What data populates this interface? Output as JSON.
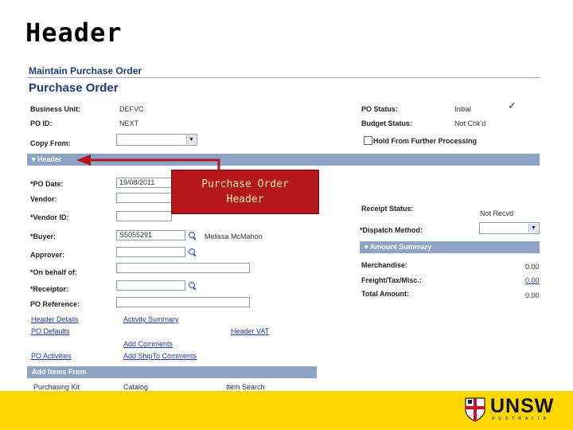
{
  "slide": {
    "title": "Header"
  },
  "app": {
    "breadcrumb": "Maintain Purchase Order",
    "page_title": "Purchase Order"
  },
  "top_fields": {
    "business_unit_label": "Business Unit:",
    "business_unit_value": "DEFVC",
    "po_id_label": "PO ID:",
    "po_id_value": "NEXT",
    "copy_from_label": "Copy From:",
    "po_status_label": "PO Status:",
    "po_status_value": "Initial",
    "budget_status_label": "Budget Status:",
    "budget_status_value": "Not Chk'd",
    "hold_label": "Hold From Further Processing"
  },
  "header_section": {
    "label": "Header"
  },
  "header_fields": {
    "po_date_label": "*PO Date:",
    "po_date_value": "19/08/2011",
    "vendor_label": "Vendor:",
    "vendor_id_label": "*Vendor ID:",
    "buyer_label": "*Buyer:",
    "buyer_value": "S5055291",
    "buyer_name": "Melissa McMahon",
    "approver_label": "Approver:",
    "on_behalf_label": "*On behalf of:",
    "receiptor_label": "*Receiptor:",
    "po_reference_label": "PO Reference:",
    "receipt_status_label": "Receipt Status:",
    "receipt_status_value": "Not Recvd",
    "dispatch_method_label": "*Dispatch Method:"
  },
  "amount_summary": {
    "title": "Amount Summary",
    "merchandise_label": "Merchandise:",
    "merchandise_value": "0.00",
    "freight_label": "Freight/Tax/Misc.:",
    "freight_value": "0.00",
    "total_label": "Total Amount:",
    "total_value": "0.00"
  },
  "links": {
    "header_details": "Header Details",
    "activity_summary": "Activity Summary",
    "po_defaults": "PO Defaults",
    "header_vat": "Header VAT",
    "add_comments": "Add Comments",
    "po_activities": "PO Activities",
    "add_shipto_comments": "Add ShipTo Comments"
  },
  "add_items": {
    "title": "Add Items From",
    "purchasing_kit": "Purchasing Kit",
    "catalog": "Catalog",
    "item_search": "Item Search"
  },
  "callout": {
    "line1": "Purchase Order",
    "line2": "Header"
  },
  "logo": {
    "text": "UNSW",
    "subtext": "AUSTRALIA"
  },
  "colors": {
    "accent_blue": "#1f3a7a",
    "section_bar": "#8ea4c6",
    "callout_red": "#b5161b",
    "footer_yellow": "#ffd700"
  }
}
